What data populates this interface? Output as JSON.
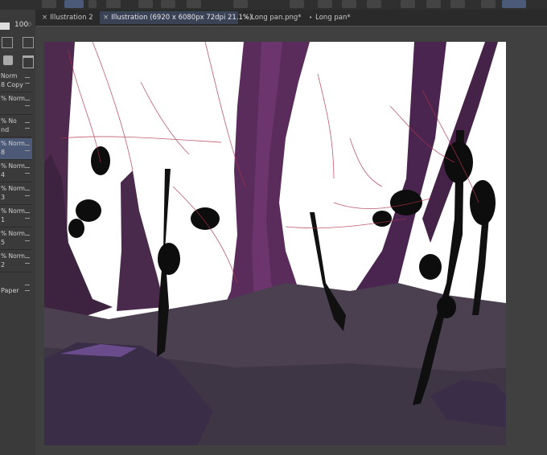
{
  "tabs": [
    {
      "label": "Illustration 2",
      "mark": "×",
      "active": false
    },
    {
      "label": "Illustration (6920 x 6080px 72dpi 21.1%)",
      "mark": "×",
      "active": true
    },
    {
      "label": "Long pan.png*",
      "mark": "•",
      "active": false
    },
    {
      "label": "Long pan*",
      "mark": "•",
      "active": false
    }
  ],
  "layer_panel": {
    "opacity_value": "100",
    "layers": [
      {
        "l1": "Norm",
        "l2": "8 Copy"
      },
      {
        "l1": "%  Norm",
        "l2": ""
      },
      {
        "l1": "%  No",
        "l2": "nd"
      },
      {
        "l1": "%  Norm",
        "l2": "8",
        "selected": true
      },
      {
        "l1": "%  Norm",
        "l2": "4"
      },
      {
        "l1": "%  Norm",
        "l2": "3"
      },
      {
        "l1": "%  Norm",
        "l2": "1"
      },
      {
        "l1": "%  Norm",
        "l2": "5"
      },
      {
        "l1": "%  Norm",
        "l2": "2"
      },
      {
        "l1": "",
        "l2": "Paper"
      }
    ]
  },
  "colors": {
    "accent": "#4c5a78",
    "trunk": "#4e2a4e",
    "ground": "#4a4050",
    "sketch_line": "#b0304a"
  }
}
